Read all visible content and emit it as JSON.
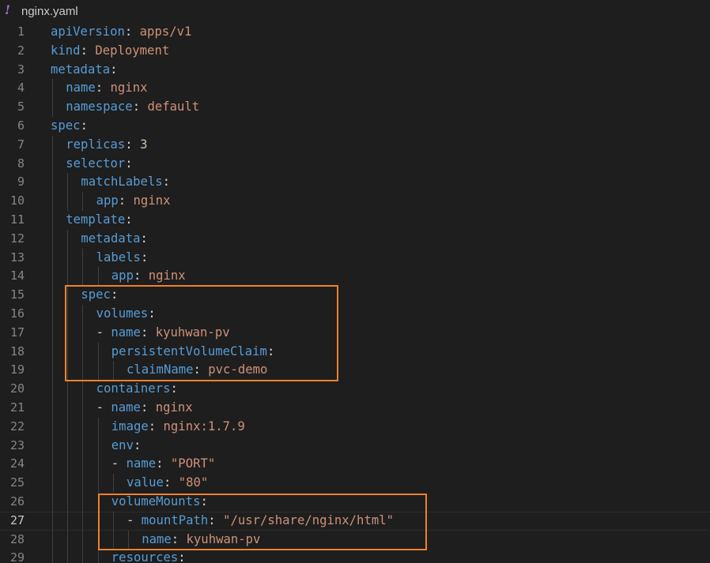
{
  "tab": {
    "icon": "!",
    "filename": "nginx.yaml"
  },
  "editor": {
    "current_line": 27,
    "lines": [
      {
        "num": "1",
        "indent": 0,
        "guides": [],
        "tokens": [
          {
            "t": "k",
            "v": "apiVersion"
          },
          {
            "t": "p",
            "v": ": "
          },
          {
            "t": "s",
            "v": "apps/v1"
          }
        ]
      },
      {
        "num": "2",
        "indent": 0,
        "guides": [],
        "tokens": [
          {
            "t": "k",
            "v": "kind"
          },
          {
            "t": "p",
            "v": ": "
          },
          {
            "t": "s",
            "v": "Deployment"
          }
        ]
      },
      {
        "num": "3",
        "indent": 0,
        "guides": [],
        "tokens": [
          {
            "t": "k",
            "v": "metadata"
          },
          {
            "t": "p",
            "v": ":"
          }
        ]
      },
      {
        "num": "4",
        "indent": 1,
        "guides": [
          0
        ],
        "tokens": [
          {
            "t": "k",
            "v": "name"
          },
          {
            "t": "p",
            "v": ": "
          },
          {
            "t": "s",
            "v": "nginx"
          }
        ]
      },
      {
        "num": "5",
        "indent": 1,
        "guides": [
          0
        ],
        "tokens": [
          {
            "t": "k",
            "v": "namespace"
          },
          {
            "t": "p",
            "v": ": "
          },
          {
            "t": "s",
            "v": "default"
          }
        ]
      },
      {
        "num": "6",
        "indent": 0,
        "guides": [],
        "tokens": [
          {
            "t": "k",
            "v": "spec"
          },
          {
            "t": "p",
            "v": ":"
          }
        ]
      },
      {
        "num": "7",
        "indent": 1,
        "guides": [
          0
        ],
        "tokens": [
          {
            "t": "k",
            "v": "replicas"
          },
          {
            "t": "p",
            "v": ": "
          },
          {
            "t": "n",
            "v": "3"
          }
        ]
      },
      {
        "num": "8",
        "indent": 1,
        "guides": [
          0
        ],
        "tokens": [
          {
            "t": "k",
            "v": "selector"
          },
          {
            "t": "p",
            "v": ":"
          }
        ]
      },
      {
        "num": "9",
        "indent": 2,
        "guides": [
          0,
          1
        ],
        "tokens": [
          {
            "t": "k",
            "v": "matchLabels"
          },
          {
            "t": "p",
            "v": ":"
          }
        ]
      },
      {
        "num": "10",
        "indent": 3,
        "guides": [
          0,
          1,
          2
        ],
        "tokens": [
          {
            "t": "k",
            "v": "app"
          },
          {
            "t": "p",
            "v": ": "
          },
          {
            "t": "s",
            "v": "nginx"
          }
        ]
      },
      {
        "num": "11",
        "indent": 1,
        "guides": [
          0
        ],
        "tokens": [
          {
            "t": "k",
            "v": "template"
          },
          {
            "t": "p",
            "v": ":"
          }
        ]
      },
      {
        "num": "12",
        "indent": 2,
        "guides": [
          0,
          1
        ],
        "tokens": [
          {
            "t": "k",
            "v": "metadata"
          },
          {
            "t": "p",
            "v": ":"
          }
        ]
      },
      {
        "num": "13",
        "indent": 3,
        "guides": [
          0,
          1,
          2
        ],
        "tokens": [
          {
            "t": "k",
            "v": "labels"
          },
          {
            "t": "p",
            "v": ":"
          }
        ]
      },
      {
        "num": "14",
        "indent": 4,
        "guides": [
          0,
          1,
          2,
          3
        ],
        "tokens": [
          {
            "t": "k",
            "v": "app"
          },
          {
            "t": "p",
            "v": ": "
          },
          {
            "t": "s",
            "v": "nginx"
          }
        ]
      },
      {
        "num": "15",
        "indent": 2,
        "guides": [
          0,
          1
        ],
        "tokens": [
          {
            "t": "k",
            "v": "spec"
          },
          {
            "t": "p",
            "v": ":"
          }
        ]
      },
      {
        "num": "16",
        "indent": 3,
        "guides": [
          0,
          1,
          2
        ],
        "tokens": [
          {
            "t": "k",
            "v": "volumes"
          },
          {
            "t": "p",
            "v": ":"
          }
        ]
      },
      {
        "num": "17",
        "indent": 3,
        "guides": [
          0,
          1,
          2
        ],
        "tokens": [
          {
            "t": "p",
            "v": "- "
          },
          {
            "t": "k",
            "v": "name"
          },
          {
            "t": "p",
            "v": ": "
          },
          {
            "t": "s",
            "v": "kyuhwan-pv"
          }
        ]
      },
      {
        "num": "18",
        "indent": 4,
        "guides": [
          0,
          1,
          2,
          3
        ],
        "tokens": [
          {
            "t": "k",
            "v": "persistentVolumeClaim"
          },
          {
            "t": "p",
            "v": ":"
          }
        ]
      },
      {
        "num": "19",
        "indent": 5,
        "guides": [
          0,
          1,
          2,
          3,
          4
        ],
        "tokens": [
          {
            "t": "k",
            "v": "claimName"
          },
          {
            "t": "p",
            "v": ": "
          },
          {
            "t": "s",
            "v": "pvc-demo"
          }
        ]
      },
      {
        "num": "20",
        "indent": 3,
        "guides": [
          0,
          1,
          2
        ],
        "tokens": [
          {
            "t": "k",
            "v": "containers"
          },
          {
            "t": "p",
            "v": ":"
          }
        ]
      },
      {
        "num": "21",
        "indent": 3,
        "guides": [
          0,
          1,
          2
        ],
        "tokens": [
          {
            "t": "p",
            "v": "- "
          },
          {
            "t": "k",
            "v": "name"
          },
          {
            "t": "p",
            "v": ": "
          },
          {
            "t": "s",
            "v": "nginx"
          }
        ]
      },
      {
        "num": "22",
        "indent": 4,
        "guides": [
          0,
          1,
          2,
          3
        ],
        "tokens": [
          {
            "t": "k",
            "v": "image"
          },
          {
            "t": "p",
            "v": ": "
          },
          {
            "t": "s",
            "v": "nginx:1.7.9"
          }
        ]
      },
      {
        "num": "23",
        "indent": 4,
        "guides": [
          0,
          1,
          2,
          3
        ],
        "tokens": [
          {
            "t": "k",
            "v": "env"
          },
          {
            "t": "p",
            "v": ":"
          }
        ]
      },
      {
        "num": "24",
        "indent": 4,
        "guides": [
          0,
          1,
          2,
          3
        ],
        "tokens": [
          {
            "t": "p",
            "v": "- "
          },
          {
            "t": "k",
            "v": "name"
          },
          {
            "t": "p",
            "v": ": "
          },
          {
            "t": "s",
            "v": "\"PORT\""
          }
        ]
      },
      {
        "num": "25",
        "indent": 5,
        "guides": [
          0,
          1,
          2,
          3,
          4
        ],
        "tokens": [
          {
            "t": "k",
            "v": "value"
          },
          {
            "t": "p",
            "v": ": "
          },
          {
            "t": "s",
            "v": "\"80\""
          }
        ]
      },
      {
        "num": "26",
        "indent": 4,
        "guides": [
          0,
          1,
          2,
          3
        ],
        "tokens": [
          {
            "t": "k",
            "v": "volumeMounts"
          },
          {
            "t": "p",
            "v": ":"
          }
        ]
      },
      {
        "num": "27",
        "indent": 5,
        "guides": [
          0,
          1,
          2,
          3,
          4
        ],
        "tokens": [
          {
            "t": "p",
            "v": "- "
          },
          {
            "t": "k",
            "v": "mountPath"
          },
          {
            "t": "p",
            "v": ": "
          },
          {
            "t": "s",
            "v": "\"/usr/share/nginx/html\""
          }
        ]
      },
      {
        "num": "28",
        "indent": 6,
        "guides": [
          0,
          1,
          2,
          3,
          4,
          5
        ],
        "tokens": [
          {
            "t": "k",
            "v": "name"
          },
          {
            "t": "p",
            "v": ": "
          },
          {
            "t": "s",
            "v": "kyuhwan-pv"
          }
        ]
      },
      {
        "num": "29",
        "indent": 4,
        "guides": [
          0,
          1,
          2,
          3
        ],
        "tokens": [
          {
            "t": "k",
            "v": "resources"
          },
          {
            "t": "p",
            "v": ":"
          }
        ]
      }
    ]
  },
  "annotations": [
    {
      "name": "highlight-box-volumes",
      "from_line": 15,
      "to_line": 19,
      "color": "#f0802c"
    },
    {
      "name": "highlight-box-volume-mounts",
      "from_line": 26,
      "to_line": 28,
      "color": "#f0802c"
    }
  ],
  "colors": {
    "background": "#1e1e1e",
    "key": "#569cd6",
    "string": "#ce9178",
    "number": "#b5cea8",
    "punctuation": "#d4d4d4",
    "line_number": "#858585",
    "yaml_icon": "#a074c4",
    "highlight": "#f0802c"
  }
}
